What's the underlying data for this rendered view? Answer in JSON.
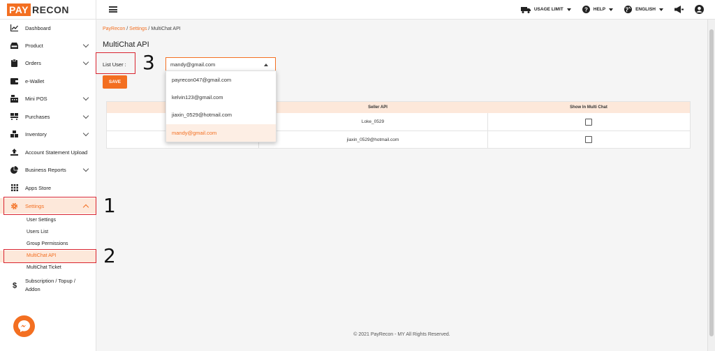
{
  "header": {
    "logo_pay": "PAY",
    "logo_recon": "RECON",
    "usage_limit": "USAGE LIMIT",
    "help": "HELP",
    "language": "ENGLISH",
    "icons": [
      "truck-icon",
      "help-icon",
      "globe-icon",
      "megaphone-icon",
      "user-account-icon"
    ]
  },
  "sidebar": {
    "items": [
      {
        "label": "Dashboard",
        "icon": "chart-line-icon"
      },
      {
        "label": "Product",
        "icon": "inbox-icon"
      },
      {
        "label": "Orders",
        "icon": "clipboard-icon"
      },
      {
        "label": "e-Wallet",
        "icon": "wallet-icon"
      },
      {
        "label": "Mini POS",
        "icon": "cash-register-icon"
      },
      {
        "label": "Purchases",
        "icon": "truck-ramp-icon"
      },
      {
        "label": "Inventory",
        "icon": "boxes-icon"
      },
      {
        "label": "Account Statement Upload",
        "icon": "upload-icon"
      },
      {
        "label": "Business Reports",
        "icon": "pie-chart-icon"
      },
      {
        "label": "Apps Store",
        "icon": "grid-icon"
      },
      {
        "label": "Settings",
        "icon": "gear-icon"
      }
    ],
    "settings_sub": [
      "User Settings",
      "Users List",
      "Group Permissions",
      "MultiChat API",
      "MultiChat Ticket"
    ],
    "subscription_line1": "Subscription / Topup /",
    "subscription_line2": "Addon",
    "active_color": "#f36f21"
  },
  "breadcrumb": {
    "home": "PayRecon",
    "sep": "/",
    "settings": "Settings",
    "current": "MultiChat API"
  },
  "page": {
    "title": "MultiChat API",
    "list_user_label": "List User :",
    "selected_user": "mandy@gmail.com",
    "save_label": "SAVE"
  },
  "dropdown": {
    "options": [
      "payrecon047@gmail.com",
      "kelvin123@gmail.com",
      "jiaxin_0529@hotmail.com",
      "mandy@gmail.com"
    ],
    "selected_index": 3
  },
  "table": {
    "columns": [
      "Seller API",
      "Show In Multi Chat"
    ],
    "rows": [
      {
        "seller_api": "Loke_0529",
        "show": false
      },
      {
        "seller_api": "jiaxin_0529@hotmail.com",
        "show": false
      }
    ]
  },
  "annotations": [
    "1",
    "2",
    "3"
  ],
  "footer": "© 2021 PayRecon - MY All Rights Reserved."
}
